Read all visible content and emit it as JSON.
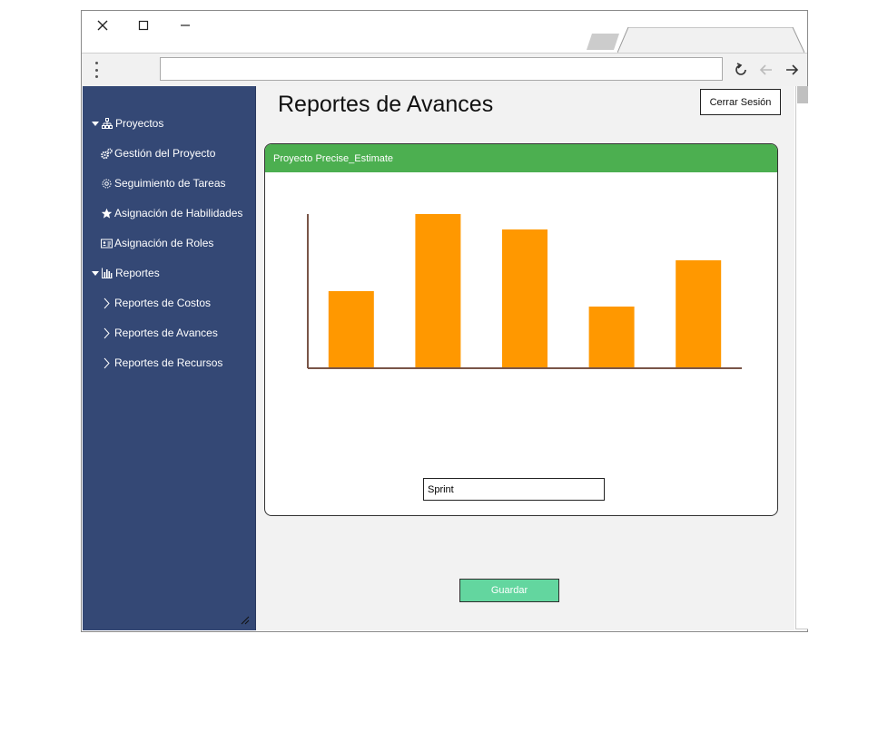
{
  "window": {
    "controls": [
      "close-icon",
      "maximize-icon",
      "minimize-icon"
    ]
  },
  "toolbar": {
    "url": "",
    "icons": [
      "menu-dots-icon",
      "reload-icon",
      "back-icon",
      "forward-icon"
    ]
  },
  "sidebar": {
    "sections": [
      {
        "label": "Proyectos",
        "icon": "sitemap-icon",
        "items": [
          {
            "label": "Gestión del Proyecto",
            "icon": "gears-icon"
          },
          {
            "label": "Seguimiento de Tareas",
            "icon": "gear-icon"
          },
          {
            "label": "Asignación de Habilidades",
            "icon": "star-icon"
          },
          {
            "label": "Asignación de Roles",
            "icon": "id-card-icon"
          }
        ]
      },
      {
        "label": "Reportes",
        "icon": "bar-chart-icon",
        "items": [
          {
            "label": "Reportes de Costos",
            "icon": "chevron-right-icon"
          },
          {
            "label": "Reportes de Avances",
            "icon": "chevron-right-icon"
          },
          {
            "label": "Reportes de Recursos",
            "icon": "chevron-right-icon"
          }
        ]
      }
    ]
  },
  "main": {
    "title": "Reportes de Avances",
    "logout_label": "Cerrar Sesión",
    "card_title": "Proyecto Precise_Estimate",
    "sprint_value": "Sprint",
    "save_label": "Guardar"
  },
  "colors": {
    "sidebar": "#344875",
    "header": "#4caf50",
    "bars": "#ff9800",
    "axis": "#795548",
    "save_button": "#63d69f"
  },
  "chart_data": {
    "type": "bar",
    "categories": [
      "",
      "",
      "",
      "",
      ""
    ],
    "values": [
      50,
      100,
      90,
      40,
      70
    ],
    "ylim": [
      0,
      100
    ],
    "grid": false,
    "title": "",
    "xlabel": "",
    "ylabel": ""
  }
}
